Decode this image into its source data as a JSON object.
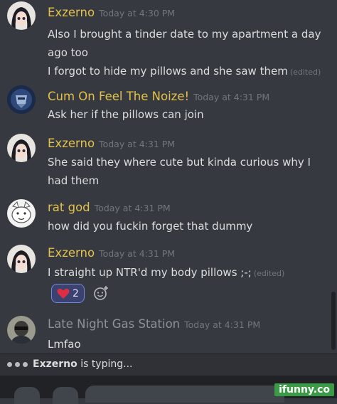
{
  "messages": [
    {
      "author": "Exzerno",
      "author_color": "#e3c24a",
      "timestamp": "Today at 4:30 PM",
      "lines": [
        "Also I brought a tinder date to my apartment a day ago too",
        "I forgot to hide my pillows and she saw them"
      ],
      "edited": "(edited)"
    },
    {
      "author": "Cum On Feel The Noize!",
      "author_color": "#e3c24a",
      "timestamp": "Today at 4:31 PM",
      "lines": [
        "Ask her if the pillows can join"
      ]
    },
    {
      "author": "Exzerno",
      "author_color": "#e3c24a",
      "timestamp": "Today at 4:31 PM",
      "lines": [
        "She said they where cute but kinda curious why I had them"
      ]
    },
    {
      "author": "rat god",
      "author_color": "#e3c24a",
      "timestamp": "Today at 4:31 PM",
      "lines": [
        "how did you fuckin forget that dummy"
      ]
    },
    {
      "author": "Exzerno",
      "author_color": "#e3c24a",
      "timestamp": "Today at 4:31 PM",
      "lines": [
        "I straight  up NTR'd my body pillows ;-;"
      ],
      "edited": "(edited)",
      "reaction": {
        "emoji": "heart-icon",
        "count": "2"
      }
    },
    {
      "author": "Late Night Gas Station",
      "author_color": "#8e9297",
      "timestamp": "Today at 4:31 PM",
      "lines": [
        "Lmfao"
      ]
    }
  ],
  "typing": {
    "user": "Exzerno",
    "suffix": "is typing..."
  },
  "watermark": "ifunny.co"
}
